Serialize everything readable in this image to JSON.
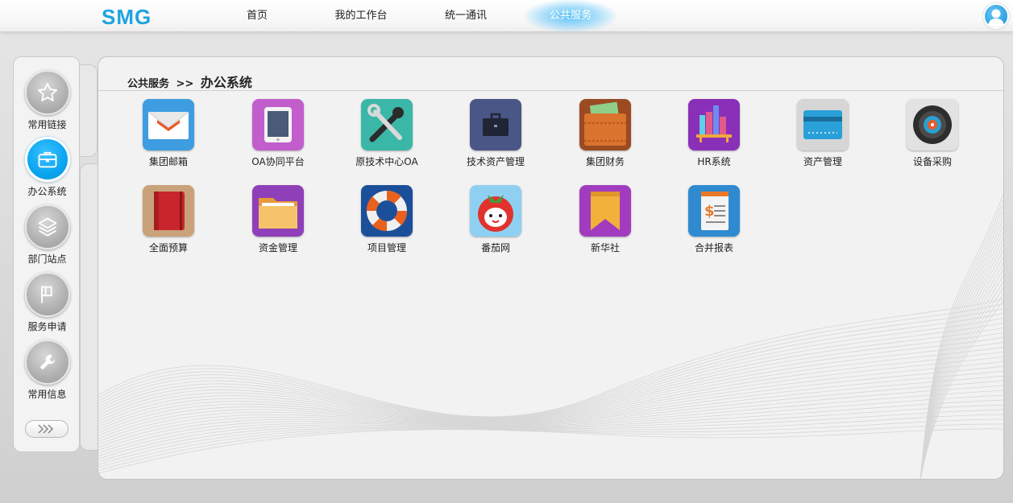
{
  "header": {
    "logo": "SMG",
    "nav": [
      {
        "label": "首页"
      },
      {
        "label": "我的工作台"
      },
      {
        "label": "统一通讯"
      },
      {
        "label": "公共服务",
        "active": true
      }
    ],
    "user_icon": "user-avatar-icon"
  },
  "sidebar": {
    "items": [
      {
        "label": "常用链接",
        "icon": "star-icon"
      },
      {
        "label": "办公系统",
        "icon": "briefcase-icon",
        "active": true
      },
      {
        "label": "部门站点",
        "icon": "layers-icon"
      },
      {
        "label": "服务申请",
        "icon": "flag-icon"
      },
      {
        "label": "常用信息",
        "icon": "wrench-icon"
      }
    ],
    "more_icon": "chevrons-right-icon"
  },
  "breadcrumb": {
    "parent": "公共服务",
    "separator": ">>",
    "current": "办公系统"
  },
  "apps": [
    {
      "label": "集团邮箱",
      "icon": "mail-icon"
    },
    {
      "label": "OA协同平台",
      "icon": "tablet-icon"
    },
    {
      "label": "原技术中心OA",
      "icon": "tools-icon"
    },
    {
      "label": "技术资产管理",
      "icon": "briefcase-icon"
    },
    {
      "label": "集团财务",
      "icon": "wallet-icon"
    },
    {
      "label": "HR系统",
      "icon": "bookshelf-icon"
    },
    {
      "label": "资产管理",
      "icon": "card-icon"
    },
    {
      "label": "设备采购",
      "icon": "target-icon"
    },
    {
      "label": "全面预算",
      "icon": "notebook-icon"
    },
    {
      "label": "资金管理",
      "icon": "folder-icon"
    },
    {
      "label": "项目管理",
      "icon": "lifebuoy-icon"
    },
    {
      "label": "番茄网",
      "icon": "tomato-icon"
    },
    {
      "label": "新华社",
      "icon": "bookmark-icon"
    },
    {
      "label": "合并报表",
      "icon": "report-icon"
    }
  ],
  "colors": {
    "accent": "#1fa3e0",
    "active_sidebar": "#0aa5f0"
  }
}
